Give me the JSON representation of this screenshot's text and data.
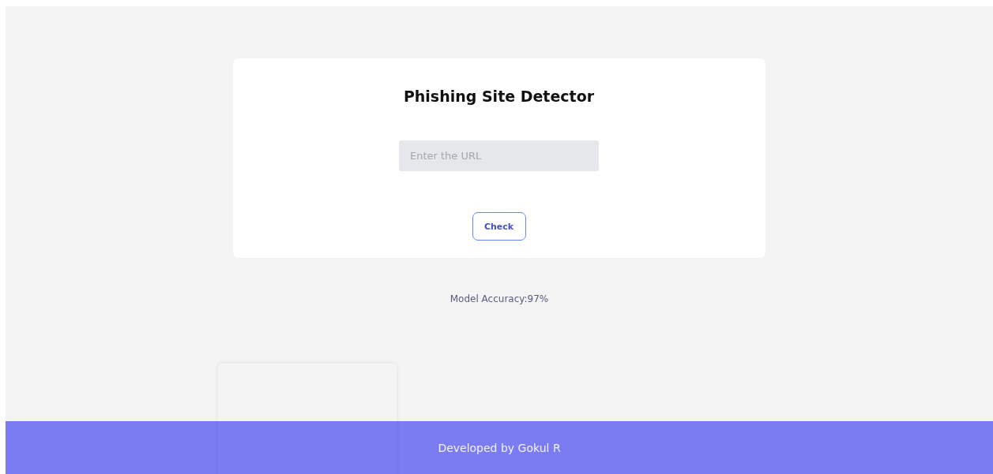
{
  "title": "Phishing Site Detector",
  "url_field": {
    "placeholder": "Enter the URL"
  },
  "check_button": "Check",
  "accuracy": "Model Accuracy:97%",
  "footer": "Developed by Gokul R"
}
